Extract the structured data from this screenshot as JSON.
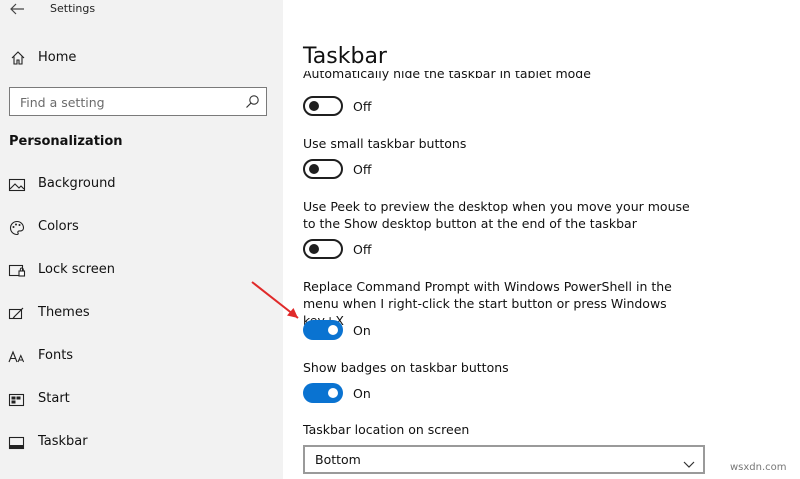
{
  "window": {
    "title": "Settings"
  },
  "sidebar": {
    "home": {
      "label": "Home",
      "icon": "home-icon"
    },
    "search": {
      "placeholder": "Find a setting",
      "icon": "search-icon"
    },
    "section": "Personalization",
    "items": [
      {
        "label": "Background",
        "icon": "image-icon"
      },
      {
        "label": "Colors",
        "icon": "palette-icon"
      },
      {
        "label": "Lock screen",
        "icon": "lock-screen-icon"
      },
      {
        "label": "Themes",
        "icon": "brush-icon"
      },
      {
        "label": "Fonts",
        "icon": "fonts-icon"
      },
      {
        "label": "Start",
        "icon": "start-icon"
      },
      {
        "label": "Taskbar",
        "icon": "taskbar-icon"
      }
    ]
  },
  "main": {
    "title": "Taskbar",
    "settings": [
      {
        "label": "Automatically hide the taskbar in tablet mode",
        "state": "Off",
        "on": false
      },
      {
        "label": "Use small taskbar buttons",
        "state": "Off",
        "on": false
      },
      {
        "label": "Use Peek to preview the desktop when you move your mouse to the Show desktop button at the end of the taskbar",
        "state": "Off",
        "on": false
      },
      {
        "label": "Replace Command Prompt with Windows PowerShell in the menu when I right-click the start button or press Windows key+X",
        "state": "On",
        "on": true
      },
      {
        "label": "Show badges on taskbar buttons",
        "state": "On",
        "on": true
      }
    ],
    "location": {
      "label": "Taskbar location on screen",
      "value": "Bottom"
    }
  },
  "colors": {
    "accent": "#0a73d1",
    "sidebar_bg": "#f2f2f2",
    "annotation_arrow": "#e02a2a"
  },
  "watermark": "wsxdn.com"
}
